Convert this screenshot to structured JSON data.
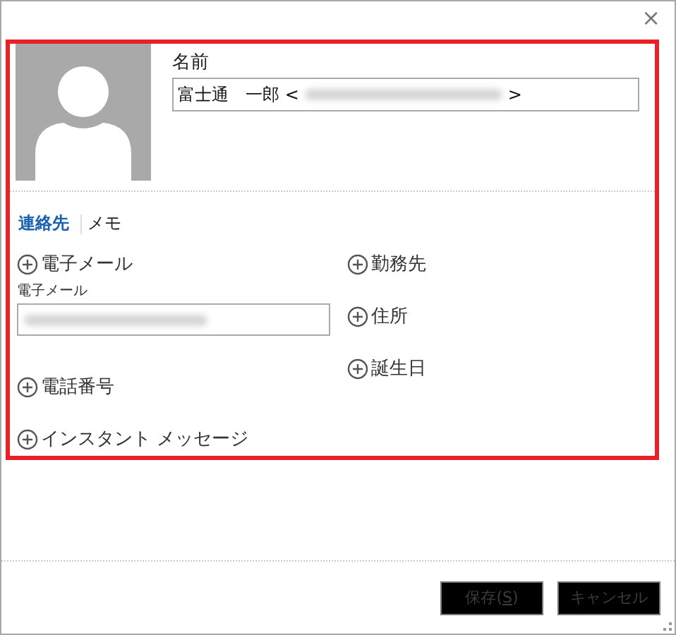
{
  "close_glyph": "×",
  "name_label": "名前",
  "name_value": "富士通　一郎 <",
  "name_value_end": ">",
  "tabs": [
    {
      "label": "連絡先",
      "selected": true
    },
    {
      "label": "メモ",
      "selected": false
    }
  ],
  "left_fields": [
    {
      "kind": "add",
      "label": "電子メール"
    },
    {
      "kind": "input",
      "label": "電子メール"
    },
    {
      "kind": "add",
      "label": "電話番号"
    },
    {
      "kind": "add",
      "label": "インスタント メッセージ"
    }
  ],
  "right_fields": [
    {
      "kind": "add",
      "label": "勤務先"
    },
    {
      "kind": "add",
      "label": "住所"
    },
    {
      "kind": "add",
      "label": "誕生日"
    }
  ],
  "buttons": [
    {
      "before": "保存(",
      "access_key": "S",
      "after": ")"
    },
    {
      "before": "キャンセル"
    }
  ]
}
